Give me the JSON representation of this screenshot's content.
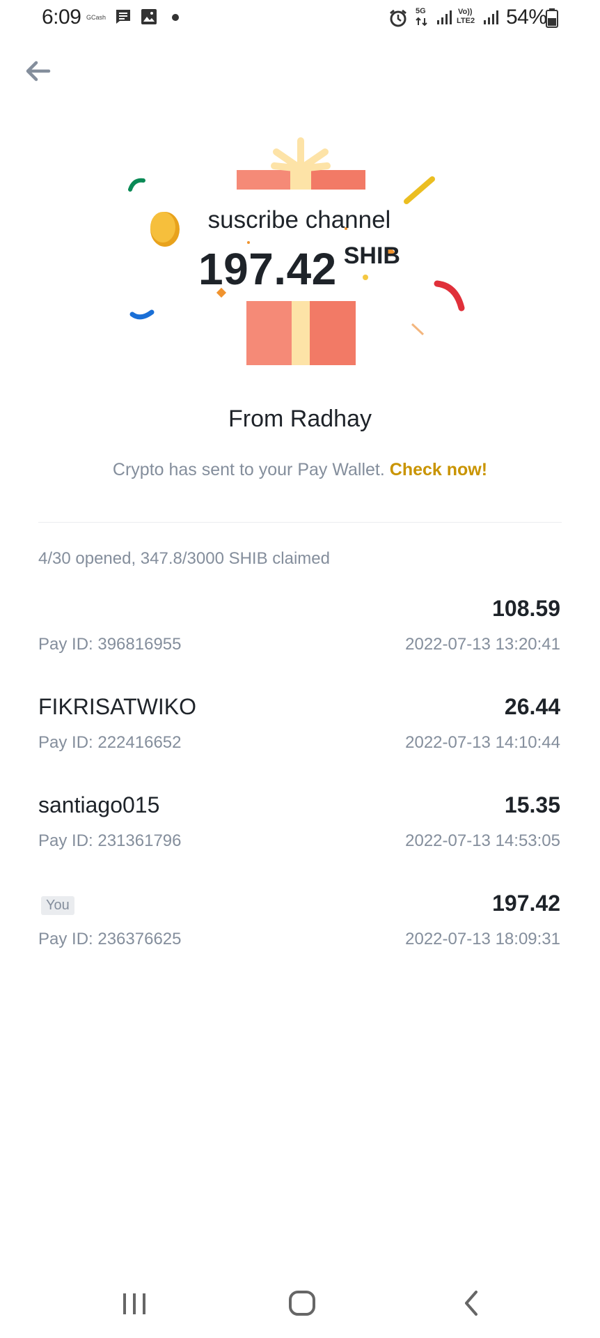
{
  "status_bar": {
    "time": "6:09",
    "gcash": "GCash",
    "network_5g": "5G",
    "volte": "Vo))",
    "lte": "LTE2",
    "battery": "54%",
    "icons": [
      "message-icon",
      "gallery-icon",
      "alarm-icon",
      "signal-icon",
      "battery-icon"
    ]
  },
  "gift": {
    "title": "suscribe channel",
    "amount": "197.42",
    "unit": "SHIB"
  },
  "from_label": "From Radhay",
  "sent_message": "Crypto has sent to your Pay Wallet.",
  "check_link": "Check now!",
  "summary": "4/30 opened, 347.8/3000 SHIB claimed",
  "claims": [
    {
      "name": "",
      "badge": "",
      "amount": "108.59",
      "pay_id": "Pay ID: 396816955",
      "time": "2022-07-13 13:20:41"
    },
    {
      "name": "FIKRISATWIKO",
      "badge": "",
      "amount": "26.44",
      "pay_id": "Pay ID: 222416652",
      "time": "2022-07-13 14:10:44"
    },
    {
      "name": "santiago015",
      "badge": "",
      "amount": "15.35",
      "pay_id": "Pay ID: 231361796",
      "time": "2022-07-13 14:53:05"
    },
    {
      "name": "",
      "badge": "You",
      "amount": "197.42",
      "pay_id": "Pay ID: 236376625",
      "time": "2022-07-13 18:09:31"
    }
  ],
  "colors": {
    "accent": "#c99400",
    "gift_red": "#f27a66",
    "gift_ribbon": "#fde3a7",
    "text_primary": "#1e2329",
    "text_secondary": "#848e9c"
  }
}
